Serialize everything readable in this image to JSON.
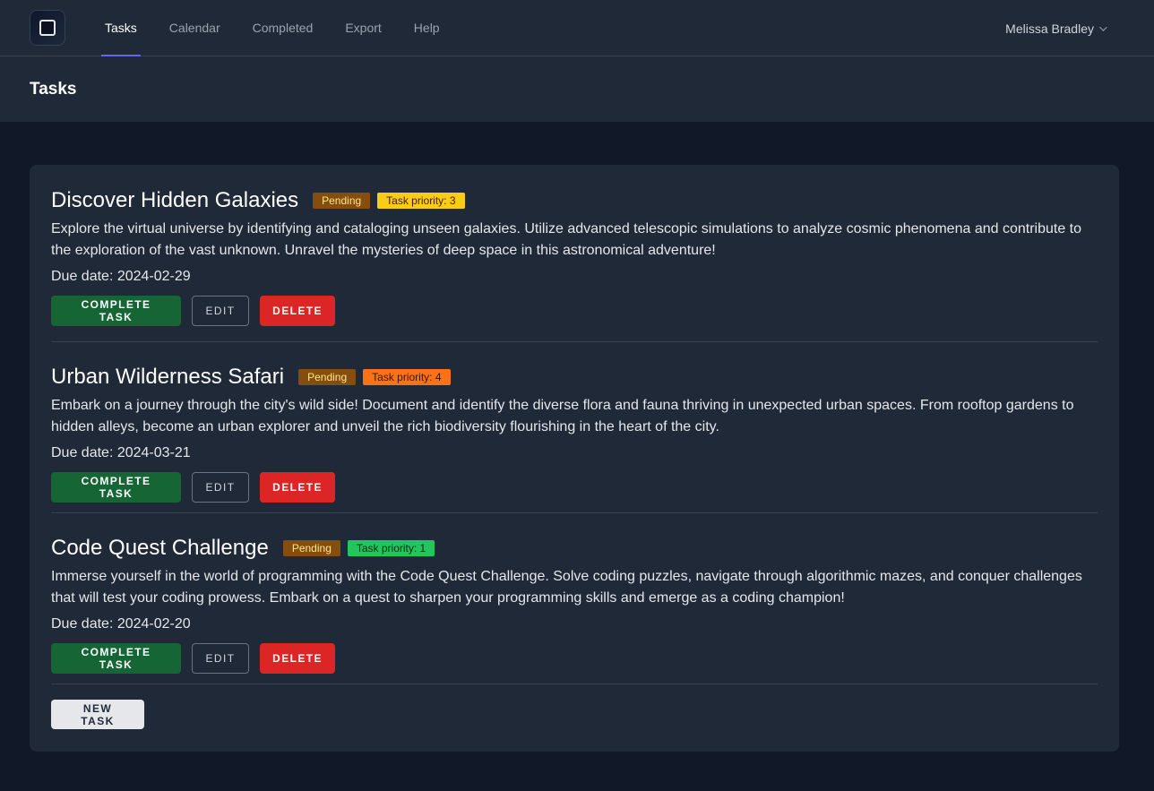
{
  "nav": {
    "links": [
      "Tasks",
      "Calendar",
      "Completed",
      "Export",
      "Help"
    ],
    "active": "Tasks",
    "user_name": "Melissa Bradley",
    "accent_color": "#6366f1"
  },
  "header": {
    "title": "Tasks"
  },
  "labels": {
    "due_prefix": "Due date: ",
    "complete": "COMPLETE TASK",
    "edit": "EDIT",
    "delete": "DELETE",
    "new_task": "NEW TASK"
  },
  "tasks": [
    {
      "title": "Discover Hidden Galaxies",
      "status": "Pending",
      "priority_label": "Task priority: 3",
      "priority_color": "#facc15",
      "priority_text_color": "#422006",
      "description": "Explore the virtual universe by identifying and cataloging unseen galaxies. Utilize advanced telescopic simulations to analyze cosmic phenomena and contribute to the exploration of the vast unknown. Unravel the mysteries of deep space in this astronomical adventure!",
      "due": "2024-02-29"
    },
    {
      "title": "Urban Wilderness Safari",
      "status": "Pending",
      "priority_label": "Task priority: 4",
      "priority_color": "#f97316",
      "priority_text_color": "#431407",
      "description": "Embark on a journey through the city's wild side! Document and identify the diverse flora and fauna thriving in unexpected urban spaces. From rooftop gardens to hidden alleys, become an urban explorer and unveil the rich biodiversity flourishing in the heart of the city.",
      "due": "2024-03-21"
    },
    {
      "title": "Code Quest Challenge",
      "status": "Pending",
      "priority_label": "Task priority: 1",
      "priority_color": "#22c55e",
      "priority_text_color": "#052e16",
      "description": "Immerse yourself in the world of programming with the Code Quest Challenge. Solve coding puzzles, navigate through algorithmic mazes, and conquer challenges that will test your coding prowess. Embark on a quest to sharpen your programming skills and emerge as a coding champion!",
      "due": "2024-02-20"
    }
  ]
}
